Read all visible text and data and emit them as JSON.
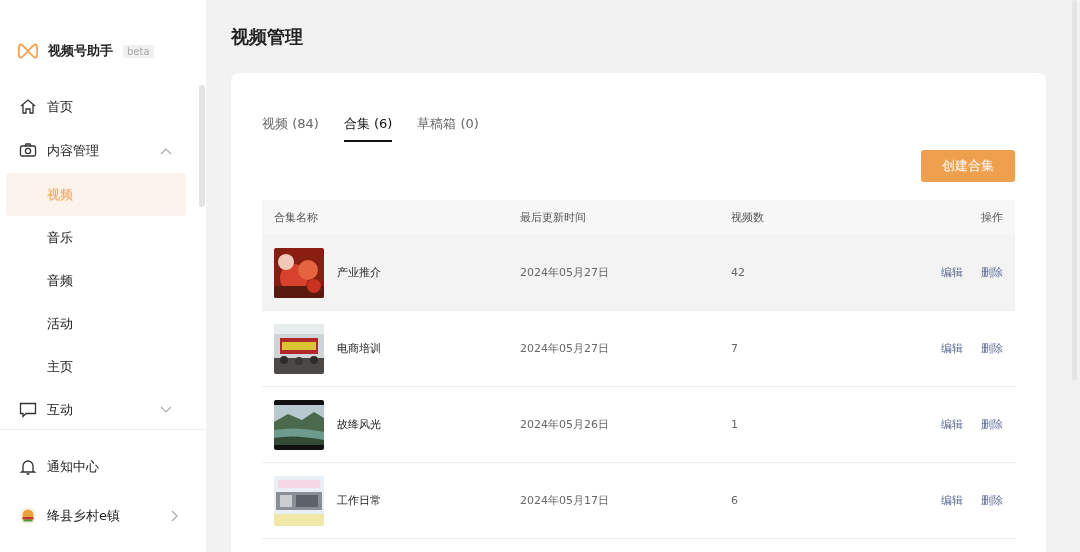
{
  "app": {
    "name": "视频号助手",
    "badge": "beta"
  },
  "sidebar": {
    "items": [
      {
        "label": "首页"
      },
      {
        "label": "内容管理",
        "expanded": true,
        "children": [
          {
            "label": "视频",
            "selected": true
          },
          {
            "label": "音乐",
            "selected": false
          },
          {
            "label": "音频",
            "selected": false
          },
          {
            "label": "活动",
            "selected": false
          },
          {
            "label": "主页",
            "selected": false
          }
        ]
      },
      {
        "label": "互动",
        "expanded": false
      }
    ],
    "footer": [
      {
        "label": "通知中心"
      },
      {
        "label": "绛县乡村e镇"
      }
    ]
  },
  "page": {
    "title": "视频管理"
  },
  "tabs": [
    {
      "label": "视频 (84)",
      "selected": false
    },
    {
      "label": "合集 (6)",
      "selected": true
    },
    {
      "label": "草稿箱 (0)",
      "selected": false
    }
  ],
  "create_button": "创建合集",
  "table": {
    "columns": [
      "合集名称",
      "最后更新时间",
      "视频数",
      "操作"
    ],
    "rows": [
      {
        "thumbnail": {
          "kind": "picture"
        },
        "name": "产业推介",
        "updated": "2024年05月27日",
        "count": "42",
        "actions": [
          "编辑",
          "删除"
        ],
        "selected": true
      },
      {
        "thumbnail": {
          "kind": "picture"
        },
        "name": "电商培训",
        "updated": "2024年05月27日",
        "count": "7",
        "actions": [
          "编辑",
          "删除"
        ],
        "selected": false
      },
      {
        "thumbnail": {
          "kind": "picture"
        },
        "name": "故绛风光",
        "updated": "2024年05月26日",
        "count": "1",
        "actions": [
          "编辑",
          "删除"
        ],
        "selected": false
      },
      {
        "thumbnail": {
          "kind": "picture"
        },
        "name": "工作日常",
        "updated": "2024年05月17日",
        "count": "6",
        "actions": [
          "编辑",
          "删除"
        ],
        "selected": false
      }
    ]
  }
}
